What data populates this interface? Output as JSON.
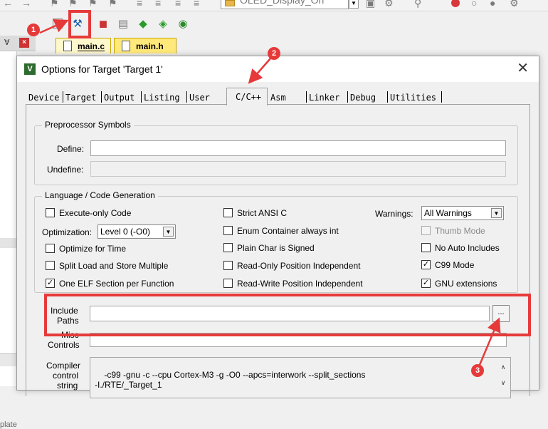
{
  "ide": {
    "project_name": "OLED_Display_On",
    "file_tabs": [
      "main.c",
      "main.h"
    ],
    "panel_hint": "plate"
  },
  "dialog": {
    "title": "Options for Target 'Target 1'",
    "close_glyph": "✕",
    "tabs": [
      "Device",
      "Target",
      "Output",
      "Listing",
      "User",
      "C/C++",
      "Asm",
      "Linker",
      "Debug",
      "Utilities"
    ],
    "active_tab": "C/C++",
    "preprocessor": {
      "legend": "Preprocessor Symbols",
      "define_label": "Define:",
      "define_value": "",
      "undefine_label": "Undefine:",
      "undefine_value": ""
    },
    "language": {
      "legend": "Language / Code Generation",
      "execute_only": {
        "label": "Execute-only Code",
        "checked": false
      },
      "optimization_label": "Optimization:",
      "optimization_value": "Level 0 (-O0)",
      "optimize_time": {
        "label": "Optimize for Time",
        "checked": false
      },
      "split_load": {
        "label": "Split Load and Store Multiple",
        "checked": false
      },
      "one_elf": {
        "label": "One ELF Section per Function",
        "checked": true
      },
      "strict_ansi": {
        "label": "Strict ANSI C",
        "checked": false
      },
      "enum_container": {
        "label": "Enum Container always int",
        "checked": false
      },
      "plain_char": {
        "label": "Plain Char is Signed",
        "checked": false
      },
      "ro_position": {
        "label": "Read-Only Position Independent",
        "checked": false
      },
      "rw_position": {
        "label": "Read-Write Position Independent",
        "checked": false
      },
      "warnings_label": "Warnings:",
      "warnings_value": "All Warnings",
      "thumb_mode": {
        "label": "Thumb Mode",
        "checked": false
      },
      "no_auto_includes": {
        "label": "No Auto Includes",
        "checked": false
      },
      "c99_mode": {
        "label": "C99 Mode",
        "checked": true
      },
      "gnu_extensions": {
        "label": "GNU extensions",
        "checked": true
      }
    },
    "include_paths_label_1": "Include",
    "include_paths_label_2": "Paths",
    "include_paths_value": "",
    "browse_label": "...",
    "misc_label_1": "Misc",
    "misc_label_2": "Controls",
    "misc_value": "",
    "compiler_label_1": "Compiler",
    "compiler_label_2": "control",
    "compiler_label_3": "string",
    "compiler_string": "-c99 -gnu -c --cpu Cortex-M3 -g -O0 --apcs=interwork --split_sections\n-I./RTE/_Target_1"
  },
  "annotations": {
    "badges": [
      "1",
      "2",
      "3"
    ],
    "color": "#e63a3a"
  },
  "colors": {
    "dialog_bg": "#f0f0f0",
    "tab_h_bg": "#ffe97a",
    "tab_c_bg": "#fff8cc",
    "highlight_red": "#e63a3a"
  }
}
